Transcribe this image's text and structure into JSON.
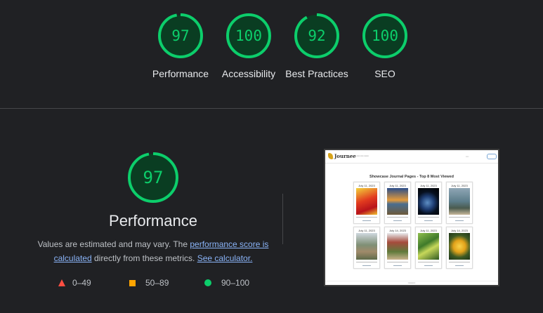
{
  "colors": {
    "pass": "#0cce6b",
    "average": "#ffa400",
    "fail": "#ff4e42",
    "background": "#202124",
    "link": "#8ab4f8"
  },
  "categories": [
    {
      "score": "97",
      "label": "Performance",
      "fraction": 0.97
    },
    {
      "score": "100",
      "label": "Accessibility",
      "fraction": 1.0
    },
    {
      "score": "92",
      "label": "Best Practices",
      "fraction": 0.92
    },
    {
      "score": "100",
      "label": "SEO",
      "fraction": 1.0
    }
  ],
  "performance": {
    "score": "97",
    "fraction": 0.97,
    "title": "Performance",
    "desc_part1": "Values are estimated and may vary. The ",
    "link_score": "performance score is calculated",
    "desc_part2": " directly from these metrics. ",
    "link_calculator": "See calculator."
  },
  "legend": [
    {
      "icon": "red-triangle-icon",
      "range": "0–49"
    },
    {
      "icon": "orange-square-icon",
      "range": "50–89"
    },
    {
      "icon": "green-circle-icon",
      "range": "90–100"
    }
  ],
  "screenshot": {
    "logo": "Journee",
    "heading": "Showcase Journal Pages - Top 8 Most Viewed",
    "cards": [
      {
        "date": "July 11, 2023",
        "image": "red-flowers"
      },
      {
        "date": "July 11, 2023",
        "image": "sunset-coast"
      },
      {
        "date": "July 11, 2023",
        "image": "earth-globe"
      },
      {
        "date": "July 11, 2023",
        "image": "rocky-beach"
      },
      {
        "date": "July 11, 2023",
        "image": "mountain-town"
      },
      {
        "date": "July 14, 2023",
        "image": "park-entrance"
      },
      {
        "date": "July 11, 2023",
        "image": "green-plants"
      },
      {
        "date": "July 14, 2023",
        "image": "yellow-rose"
      }
    ]
  }
}
